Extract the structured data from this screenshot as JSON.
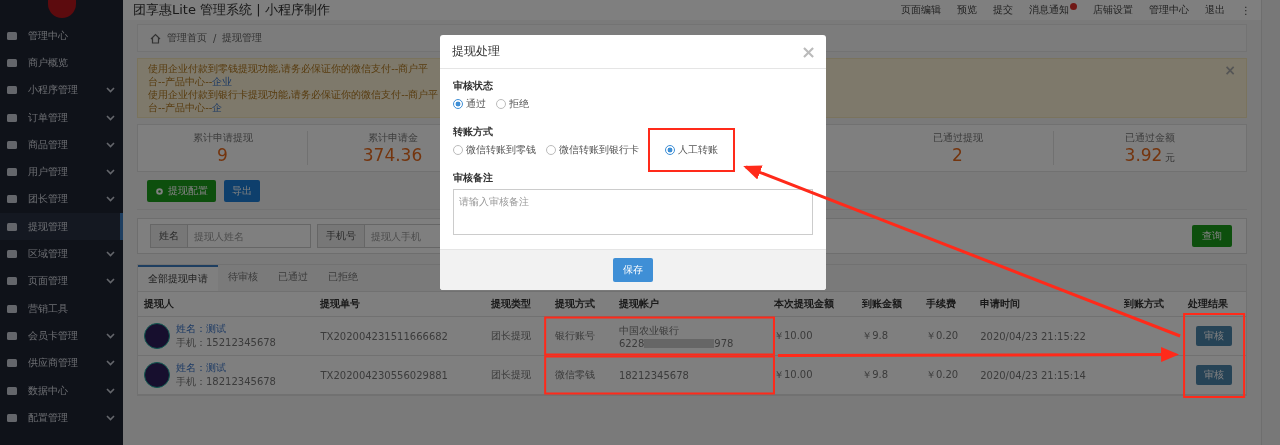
{
  "header": {
    "title": "团享惠Lite 管理系统 | 小程序制作",
    "links": [
      {
        "label": "页面编辑",
        "badge": false
      },
      {
        "label": "预览",
        "badge": false
      },
      {
        "label": "提交",
        "badge": false
      },
      {
        "label": "消息通知",
        "badge": true
      },
      {
        "label": "店铺设置",
        "badge": false
      },
      {
        "label": "管理中心",
        "badge": false
      },
      {
        "label": "退出",
        "badge": false
      }
    ],
    "more": "⋮"
  },
  "sidebar": {
    "items": [
      {
        "label": "管理中心",
        "expandable": false,
        "selected": false
      },
      {
        "label": "商户概览",
        "expandable": false,
        "selected": false
      },
      {
        "label": "小程序管理",
        "expandable": true,
        "selected": false
      },
      {
        "label": "订单管理",
        "expandable": true,
        "selected": false
      },
      {
        "label": "商品管理",
        "expandable": true,
        "selected": false
      },
      {
        "label": "用户管理",
        "expandable": true,
        "selected": false
      },
      {
        "label": "团长管理",
        "expandable": true,
        "selected": false
      },
      {
        "label": "提现管理",
        "expandable": false,
        "selected": true
      },
      {
        "label": "区域管理",
        "expandable": true,
        "selected": false
      },
      {
        "label": "页面管理",
        "expandable": true,
        "selected": false
      },
      {
        "label": "营销工具",
        "expandable": false,
        "selected": false
      },
      {
        "label": "会员卡管理",
        "expandable": true,
        "selected": false
      },
      {
        "label": "供应商管理",
        "expandable": true,
        "selected": false
      },
      {
        "label": "数据中心",
        "expandable": true,
        "selected": false
      },
      {
        "label": "配置管理",
        "expandable": true,
        "selected": false
      }
    ]
  },
  "breadcrumb": [
    "管理首页",
    "/",
    "提现管理"
  ],
  "alert": {
    "lines": [
      {
        "text": "使用企业付款到零钱提现功能,请务必保证你的微信支付--商户平台--产品中心--",
        "link": "企业"
      },
      {
        "text": "使用企业付款到银行卡提现功能,请务必保证你的微信支付--商户平台--产品中心--",
        "link": "企"
      }
    ],
    "close": "×"
  },
  "stats": [
    {
      "label": "累计申请提现",
      "value": "9"
    },
    {
      "label": "累计申请金",
      "value": "374.36"
    },
    {
      "label": "已通过提现",
      "value": "2"
    },
    {
      "label": "已通过金额",
      "value": "3.92",
      "unit": "元"
    }
  ],
  "actions": [
    {
      "label": "提现配置",
      "kind": "config"
    },
    {
      "label": "导出",
      "kind": "export"
    }
  ],
  "search": {
    "fields": [
      {
        "label": "姓名",
        "placeholder": "提现人姓名"
      },
      {
        "label": "手机号",
        "placeholder": "提现人手机"
      }
    ],
    "button": "查询"
  },
  "tabs": [
    {
      "label": "全部提现申请",
      "selected": true
    },
    {
      "label": "待审核",
      "selected": false
    },
    {
      "label": "已通过",
      "selected": false
    },
    {
      "label": "已拒绝",
      "selected": false
    }
  ],
  "table": {
    "columns": [
      "提现人",
      "提现单号",
      "提现类型",
      "提现方式",
      "提现帐户",
      "本次提现金额",
      "到账金额",
      "手续费",
      "申请时间",
      "到账方式",
      "处理结果"
    ],
    "rows": [
      {
        "name": "姓名：测试",
        "phone": "手机：15212345678",
        "order": "TX202004231511666682",
        "type": "团长提现",
        "method": "银行账号",
        "account": [
          "中国农业银行"
        ],
        "account_start": "6228",
        "account_end": "978",
        "amount": "￥10.00",
        "received": "￥9.8",
        "fee": "￥0.20",
        "time": "2020/04/23 21:15:22",
        "action": "审核"
      },
      {
        "name": "姓名：测试",
        "phone": "手机：18212345678",
        "order": "TX202004230556029881",
        "type": "团长提现",
        "method": "微信零钱",
        "account": [
          "18212345678"
        ],
        "amount": "￥10.00",
        "received": "￥9.8",
        "fee": "￥0.20",
        "time": "2020/04/23 21:15:14",
        "action": "审核"
      }
    ]
  },
  "modal": {
    "title": "提现处理",
    "close": "×",
    "groups": [
      {
        "label": "审核状态",
        "options": [
          {
            "label": "通过",
            "selected": true
          },
          {
            "label": "拒绝",
            "selected": false
          }
        ]
      },
      {
        "label": "转账方式",
        "options": [
          {
            "label": "微信转账到零钱",
            "selected": false
          },
          {
            "label": "微信转账到银行卡",
            "selected": false
          },
          {
            "label": "人工转账",
            "selected": true
          }
        ]
      }
    ],
    "remark": {
      "label": "审核备注",
      "placeholder": "请输入审核备注"
    },
    "save": "保存"
  }
}
